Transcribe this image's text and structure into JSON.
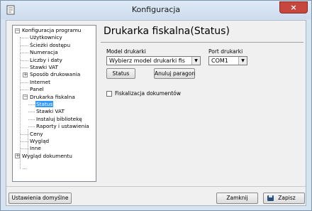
{
  "window": {
    "title": "Konfiguracja",
    "close_glyph": "×"
  },
  "tree": {
    "items": [
      {
        "label": "Konfiguracja programu",
        "level": 0,
        "expanded": true
      },
      {
        "label": "Użytkownicy",
        "level": 1
      },
      {
        "label": "Ścieżki dostępu",
        "level": 1
      },
      {
        "label": "Numeracja",
        "level": 1
      },
      {
        "label": "Liczby i daty",
        "level": 1
      },
      {
        "label": "Stawki VAT",
        "level": 1
      },
      {
        "label": "Sposób drukowania",
        "level": 1,
        "expanded": false
      },
      {
        "label": "Internet",
        "level": 1
      },
      {
        "label": "Panel",
        "level": 1
      },
      {
        "label": "Drukarka fiskalna",
        "level": 1,
        "expanded": true
      },
      {
        "label": "Status",
        "level": 2,
        "selected": true
      },
      {
        "label": "Stawki VAT",
        "level": 2
      },
      {
        "label": "Instaluj bibliotekę",
        "level": 2
      },
      {
        "label": "Raporty i ustawienia",
        "level": 2
      },
      {
        "label": "Ceny",
        "level": 1
      },
      {
        "label": "Wygląd",
        "level": 1
      },
      {
        "label": "Inne",
        "level": 1
      },
      {
        "label": "Wygląd dokumentu",
        "level": 0,
        "expanded": false
      }
    ]
  },
  "main": {
    "heading": "Drukarka fiskalna(Status)",
    "printer_model_label": "Model drukarki",
    "printer_model_value": "Wybierz model drukarki fis",
    "printer_port_label": "Port drukarki",
    "printer_port_value": "COM1",
    "status_button": "Status",
    "cancel_receipt_button": "Anuluj paragon",
    "fiscalization_checkbox_label": "Fiskalizacja dokumentów",
    "fiscalization_checked": false
  },
  "footer": {
    "defaults_button": "Ustawienia domyślne",
    "close_button": "Zamknij",
    "save_button": "Zapisz"
  },
  "colors": {
    "selection": "#3399ff",
    "close_button": "#c7463d",
    "window_frame": "#d6e4f2"
  },
  "icons": [
    "app-icon",
    "close-icon",
    "save-icon",
    "expander-minus-icon",
    "expander-plus-icon",
    "dropdown-arrow-icon"
  ]
}
